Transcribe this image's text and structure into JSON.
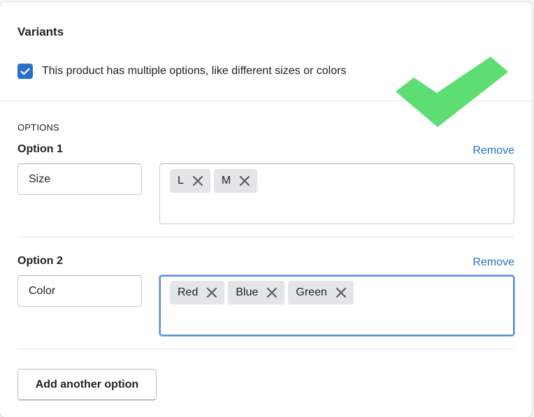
{
  "card": {
    "title": "Variants"
  },
  "multiple_options": {
    "checked": true,
    "label": "This product has multiple options, like different sizes or colors"
  },
  "options_section": {
    "heading": "OPTIONS",
    "remove_label": "Remove",
    "options": [
      {
        "label": "Option 1",
        "name_value": "Size",
        "values": [
          "L",
          "M"
        ]
      },
      {
        "label": "Option 2",
        "name_value": "Color",
        "values": [
          "Red",
          "Blue",
          "Green"
        ],
        "focused": true
      }
    ]
  },
  "add_option_button": {
    "label": "Add another option"
  },
  "colors": {
    "accent": "#2c6ecb",
    "checkmark_overlay": "#4cd964",
    "tag_bg": "#e4e5e7",
    "focus_ring": "#5c8ed8"
  },
  "icons": {
    "checkbox": "check-icon",
    "tag_remove": "close-icon",
    "overlay": "checkmark-icon"
  }
}
